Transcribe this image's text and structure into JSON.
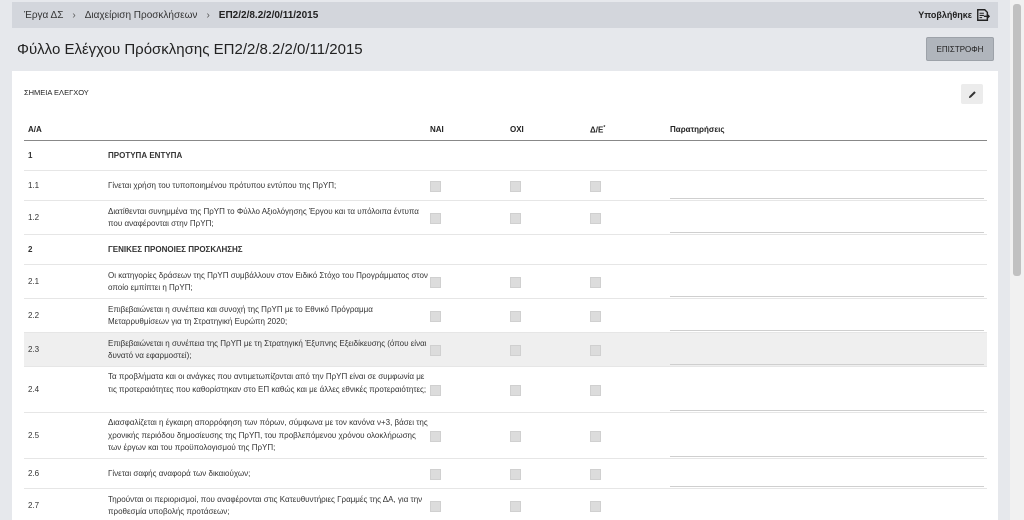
{
  "breadcrumb": {
    "items": [
      "Έργα ΔΣ",
      "Διαχείριση Προσκλήσεων"
    ],
    "current": "ΕΠ2/2/8.2/2/0/11/2015",
    "separator": "›"
  },
  "status": {
    "label": "Υποβλήθηκε",
    "icon": "submitted-document-icon"
  },
  "page": {
    "title": "Φύλλο Ελέγχου Πρόσκλησης ΕΠ2/2/8.2/2/0/11/2015",
    "back_label": "ΕΠΙΣΤΡΟΦΗ"
  },
  "section": {
    "label": "ΣΗΜΕΙΑ ΕΛΕΓΧΟΥ",
    "edit_icon": "pencil-icon"
  },
  "table": {
    "headers": {
      "no": "Α/Α",
      "yes": "ΝΑΙ",
      "no_col": "ΟΧΙ",
      "na": "Δ/Ε",
      "na_mark": "*",
      "remarks": "Παρατηρήσεις"
    },
    "rows": [
      {
        "no": "1",
        "desc": "ΠΡΟΤΥΠΑ ΕΝΤΥΠΑ",
        "group": true
      },
      {
        "no": "1.1",
        "desc": "Γίνεται χρήση του τυποποιημένου πρότυπου εντύπου της ΠρΥΠ;"
      },
      {
        "no": "1.2",
        "desc": "Διατίθενται συνημμένα της ΠρΥΠ το Φύλλο Αξιολόγησης Έργου και τα υπόλοιπα έντυπα που αναφέρονται στην ΠρΥΠ;"
      },
      {
        "no": "2",
        "desc": "ΓΕΝΙΚΕΣ ΠΡΟΝΟΙΕΣ ΠΡΟΣΚΛΗΣΗΣ",
        "group": true
      },
      {
        "no": "2.1",
        "desc": "Οι κατηγορίες δράσεων της ΠρΥΠ συμβάλλουν στον Ειδικό Στόχο του Προγράμματος στον οποίο εμπίπτει η ΠρΥΠ;"
      },
      {
        "no": "2.2",
        "desc": "Επιβεβαιώνεται η συνέπεια και συνοχή της ΠρΥΠ με το Εθνικό Πρόγραμμα Μεταρρυθμίσεων για τη Στρατηγική Ευρώπη 2020;"
      },
      {
        "no": "2.3",
        "desc": "Επιβεβαιώνεται η συνέπεια της ΠρΥΠ με τη Στρατηγική Έξυπνης Εξειδίκευσης (όπου είναι δυνατό να εφαρμοστεί);",
        "highlight": true
      },
      {
        "no": "2.4",
        "desc": "Τα προβλήματα και οι ανάγκες που αντιμετωπίζονται από την ΠρΥΠ είναι σε συμφωνία με τις προτεραιότητες που καθορίστηκαν στο ΕΠ καθώς και με άλλες εθνικές προτεραιότητες;"
      },
      {
        "no": "2.5",
        "desc": "Διασφαλίζεται η έγκαιρη απορρόφηση των πόρων, σύμφωνα με τον κανόνα ν+3, βάσει της χρονικής περιόδου δημοσίευσης της ΠρΥΠ, του προβλεπόμενου χρόνου ολοκλήρωσης των έργων και του προϋπολογισμού της ΠρΥΠ;"
      },
      {
        "no": "2.6",
        "desc": "Γίνεται σαφής αναφορά των δικαιούχων;"
      },
      {
        "no": "2.7",
        "desc": "Τηρούνται οι περιορισμοί, που αναφέρονται στις Κατευθυντήριες Γραμμές της ΔΑ, για την προθεσμία υποβολής προτάσεων;"
      }
    ]
  }
}
